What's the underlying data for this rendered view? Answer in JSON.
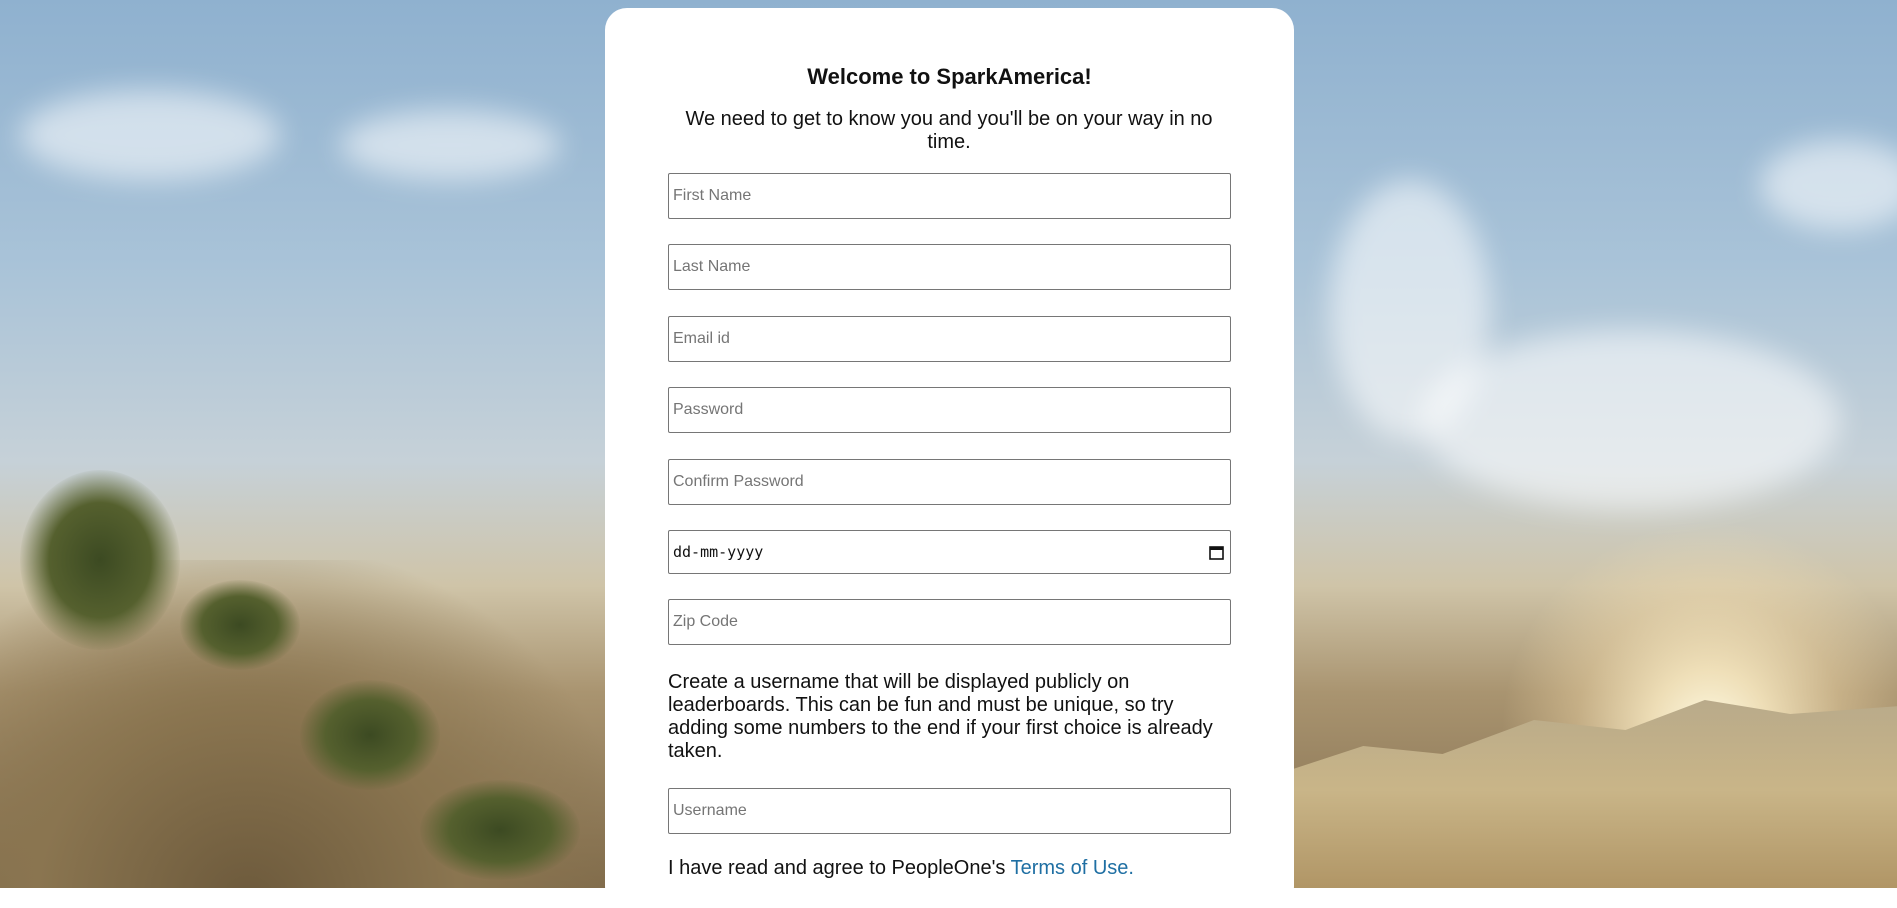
{
  "form": {
    "title": "Welcome to SparkAmerica!",
    "subtitle": "We need to get to know you and you'll be on your way in no time.",
    "first_name_placeholder": "First Name",
    "last_name_placeholder": "Last Name",
    "email_placeholder": "Email id",
    "password_placeholder": "Password",
    "confirm_password_placeholder": "Confirm Password",
    "date_placeholder": "dd-mm-yyyy",
    "zip_placeholder": "Zip Code",
    "username_info": "Create a username that will be displayed publicly on leaderboards. This can be fun and must be unique, so try adding some numbers to the end if your first choice is already taken.",
    "username_placeholder": "Username",
    "terms_prefix": "I have read and agree to PeopleOne's ",
    "terms_link": "Terms of Use."
  },
  "icons": {
    "date_picker": "calendar-icon"
  },
  "colors": {
    "link": "#1f6fa3",
    "card_background": "#ffffff"
  }
}
